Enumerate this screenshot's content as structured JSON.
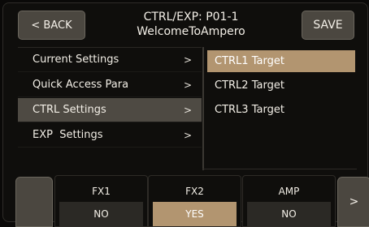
{
  "header": {
    "back_label": "< BACK",
    "title_line1": "CTRL/EXP: P01-1",
    "title_line2": "WelcomeToAmpero",
    "save_label": "SAVE"
  },
  "menu": {
    "items": [
      {
        "label": "Current Settings",
        "arrow": ">"
      },
      {
        "label": "Quick Access Para",
        "arrow": ">"
      },
      {
        "label": "CTRL Settings",
        "arrow": ">"
      },
      {
        "label": "EXP  Settings",
        "arrow": ">"
      }
    ],
    "selected_index": 2
  },
  "submenu": {
    "items": [
      {
        "label": "CTRL1 Target"
      },
      {
        "label": "CTRL2 Target"
      },
      {
        "label": "CTRL3 Target"
      }
    ],
    "selected_index": 0
  },
  "targets": [
    {
      "label": "FX1",
      "value": "NO"
    },
    {
      "label": "FX2",
      "value": "YES"
    },
    {
      "label": "AMP",
      "value": "NO"
    }
  ],
  "nav": {
    "next_label": ">"
  },
  "colors": {
    "accent": "#b29570",
    "button": "#4b4740",
    "background": "#0a0908"
  }
}
